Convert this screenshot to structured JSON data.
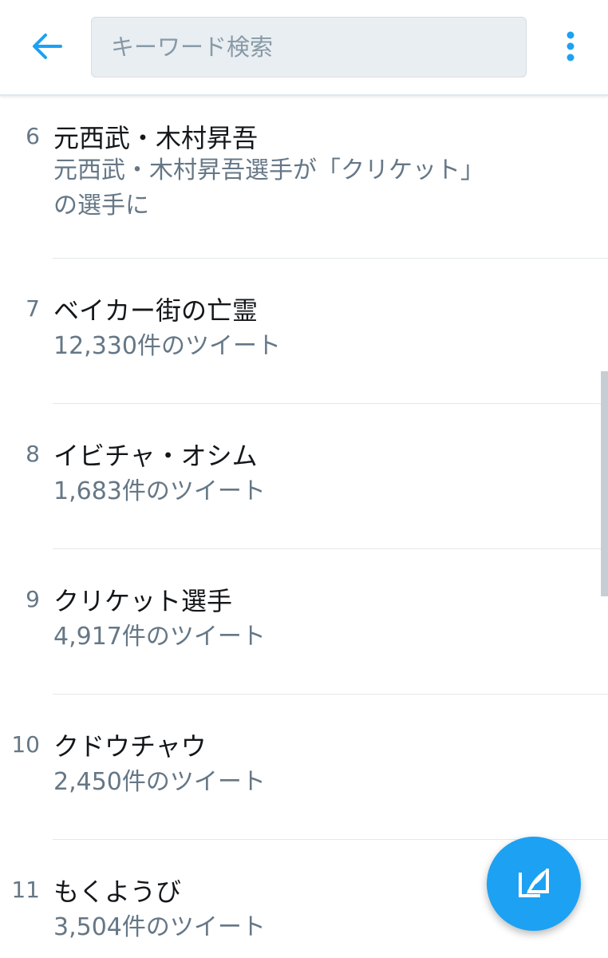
{
  "search": {
    "placeholder": "キーワード検索",
    "value": ""
  },
  "icons": {
    "back": "arrow-left-icon",
    "more": "more-vertical-icon",
    "compose": "compose-tweet-icon"
  },
  "colors": {
    "accent": "#1da1f2",
    "text_primary": "#14171a",
    "text_secondary": "#657786",
    "divider": "#e1e8ed",
    "search_background": "#e9eef2"
  },
  "trends": [
    {
      "rank": "6",
      "name": "元西武・木村昇吾",
      "description": "元西武・木村昇吾選手が「クリケット」の選手に"
    },
    {
      "rank": "7",
      "name": "ベイカー街の亡霊",
      "tweet_count": "12,330件のツイート"
    },
    {
      "rank": "8",
      "name": "イビチャ・オシム",
      "tweet_count": "1,683件のツイート"
    },
    {
      "rank": "9",
      "name": "クリケット選手",
      "tweet_count": "4,917件のツイート"
    },
    {
      "rank": "10",
      "name": "クドウチャウ",
      "tweet_count": "2,450件のツイート"
    },
    {
      "rank": "11",
      "name": "もくようび",
      "tweet_count": "3,504件のツイート"
    }
  ]
}
